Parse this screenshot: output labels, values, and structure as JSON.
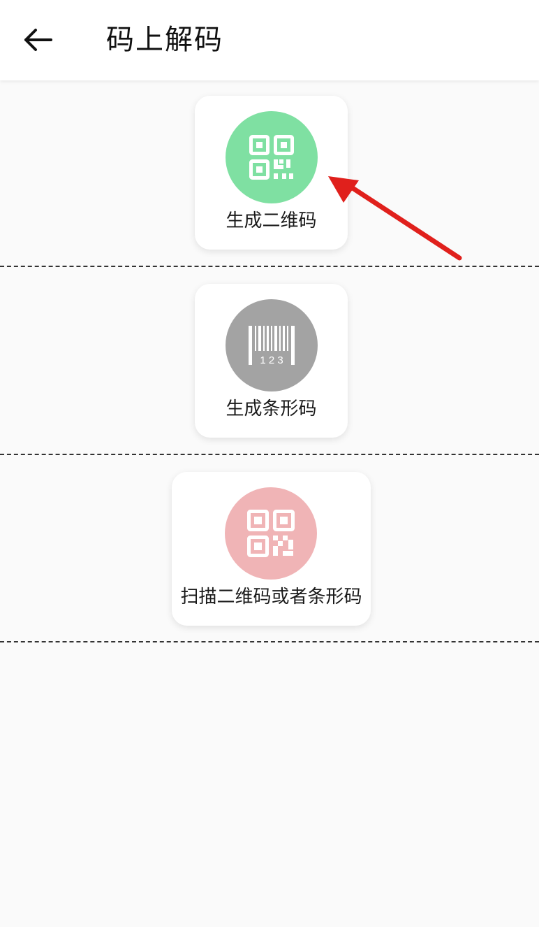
{
  "header": {
    "title": "码上解码",
    "back_icon": "arrow-left-icon"
  },
  "cards": [
    {
      "label": "生成二维码",
      "icon": "qr-code-icon",
      "color": "#7fe0a2"
    },
    {
      "label": "生成条形码",
      "icon": "barcode-icon",
      "color": "#a3a3a3"
    },
    {
      "label": "扫描二维码或者条形码",
      "icon": "qr-scan-icon",
      "color": "#f0b4b6"
    }
  ],
  "barcode_digits": "1 2 3",
  "annotation": {
    "icon": "red-arrow-icon",
    "color": "#e0201c"
  },
  "colors": {
    "background": "#fafafa",
    "app_bar": "#ffffff",
    "divider": "#333333"
  }
}
